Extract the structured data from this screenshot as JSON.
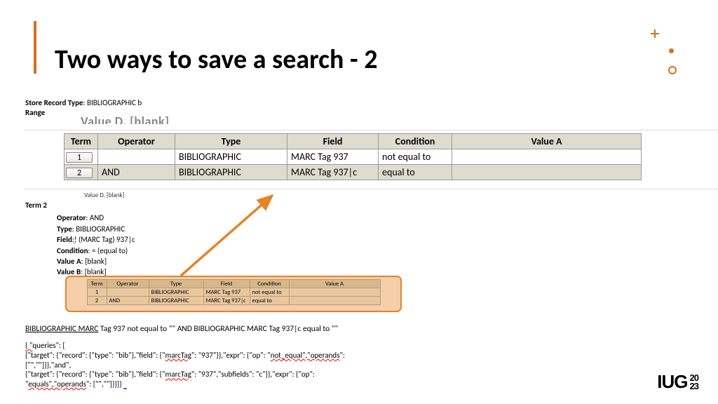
{
  "title": "Two ways to save a search - 2",
  "meta": {
    "storeRecordTypeLabel": "Store Record Type",
    "storeRecordType": "BIBLIOGRAPHIC b",
    "rangeLabel": "Range"
  },
  "valueB_cut": "Value D. [blank]",
  "table": {
    "headers": {
      "term": "Term",
      "operator": "Operator",
      "type": "Type",
      "field": "Field",
      "condition": "Condition",
      "valueA": "Value A"
    },
    "rows": [
      {
        "term": "1",
        "operator": "",
        "type": "BIBLIOGRAPHIC",
        "field": "MARC Tag 937",
        "condition": "not equal to",
        "valueA": ""
      },
      {
        "term": "2",
        "operator": "AND",
        "type": "BIBLIOGRAPHIC",
        "field": "MARC Tag 937|c",
        "condition": "equal to",
        "valueA": ""
      }
    ]
  },
  "valBlank": "Value D. [blank]",
  "term2": {
    "heading": "Term 2",
    "operatorLabel": "Operator",
    "operator": "AND",
    "typeLabel": "Type",
    "type": "BIBLIOGRAPHIC",
    "fieldLabel": "Field",
    "fieldU": "!",
    "fieldRest": " (MARC Tag) 937|c",
    "conditionLabel": "Condition",
    "condition": "= (equal to)",
    "valueALabel": "Value A",
    "valueA": "[blank]",
    "valueBLabel": "Value B",
    "valueB": "[blank]"
  },
  "sentence": {
    "part1u": "BIBLIOGRAPHIC  MARC",
    "part2": " Tag 937  not equal to  \"\"    AND BIBLIOGRAPHIC  MARC Tag 937|c  equal to  \"\""
  },
  "json": {
    "l1a": "{  \"",
    "l1b": "queries\": [",
    "l2a": "{\"target\": {\"record\": {\"type\": \"bib\"},\"field\": {\"",
    "l2b": "marcTag",
    "l2c": "\": \"937\"}},\"expr\": {\"op\": \"",
    "l2d": "not_equal\",\"operands",
    "l2e": "\":",
    "l3": "[\"\",\"\"]}},\"and\",",
    "l4a": "{\"target\": {\"record\": {\"type\": \"bib\"},\"field\": {\"",
    "l4b": "marcTag",
    "l4c": "\": \"937\",\"subfields\": \"c\"}},\"expr\": {\"op\":",
    "l5a": "\"",
    "l5b": "equals\",\"operands",
    "l5c": "\": [\"\",\"\"]}}]}"
  },
  "logo": {
    "text": "IUG",
    "y1": "20",
    "y2": "23"
  }
}
